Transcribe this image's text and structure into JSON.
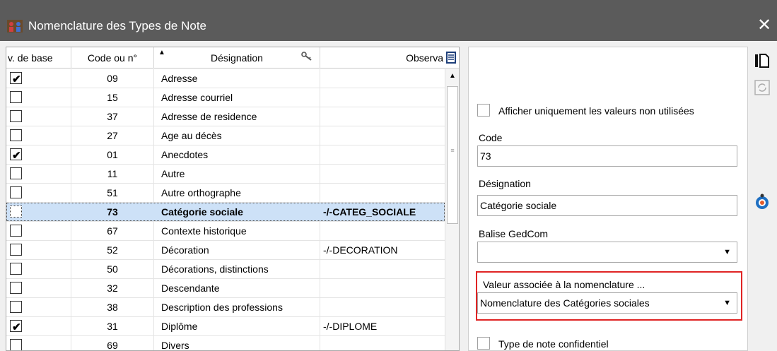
{
  "window": {
    "title": "Nomenclature des Types de Note",
    "close_label": "✕"
  },
  "grid": {
    "headers": {
      "base": "v. de base",
      "code": "Code ou n°",
      "designation": "Désignation",
      "observation": "Observa"
    },
    "rows": [
      {
        "checked": true,
        "code": "09",
        "designation": "Adresse",
        "observation": ""
      },
      {
        "checked": false,
        "code": "15",
        "designation": "Adresse courriel",
        "observation": ""
      },
      {
        "checked": false,
        "code": "37",
        "designation": "Adresse de residence",
        "observation": ""
      },
      {
        "checked": false,
        "code": "27",
        "designation": "Age au décès",
        "observation": ""
      },
      {
        "checked": true,
        "code": "01",
        "designation": "Anecdotes",
        "observation": ""
      },
      {
        "checked": false,
        "code": "11",
        "designation": "Autre",
        "observation": ""
      },
      {
        "checked": false,
        "code": "51",
        "designation": "Autre orthographe",
        "observation": ""
      },
      {
        "checked": false,
        "code": "73",
        "designation": "Catégorie sociale",
        "observation": "-/-CATEG_SOCIALE",
        "selected": true
      },
      {
        "checked": false,
        "code": "67",
        "designation": "Contexte historique",
        "observation": ""
      },
      {
        "checked": false,
        "code": "52",
        "designation": "Décoration",
        "observation": "-/-DECORATION"
      },
      {
        "checked": false,
        "code": "50",
        "designation": "Décorations, distinctions",
        "observation": ""
      },
      {
        "checked": false,
        "code": "32",
        "designation": "Descendante",
        "observation": ""
      },
      {
        "checked": false,
        "code": "38",
        "designation": "Description des professions",
        "observation": ""
      },
      {
        "checked": true,
        "code": "31",
        "designation": "Diplôme",
        "observation": "-/-DIPLOME"
      },
      {
        "checked": false,
        "code": "69",
        "designation": "Divers",
        "observation": ""
      }
    ]
  },
  "panel": {
    "unused_only_label": "Afficher uniquement les valeurs non utilisées",
    "code_label": "Code",
    "code_value": "73",
    "designation_label": "Désignation",
    "designation_value": "Catégorie sociale",
    "gedcom_label": "Balise GedCom",
    "gedcom_value": "",
    "assoc_label": "Valeur associée à la nomenclature ...",
    "assoc_value": "Nomenclature des Catégories sociales",
    "confidential_label": "Type de note confidentiel"
  },
  "colors": {
    "titlebar": "#5b5b5b",
    "selection": "#cde1f7",
    "highlight_border": "#e02424",
    "accent_icon": "#1e6fc2"
  }
}
